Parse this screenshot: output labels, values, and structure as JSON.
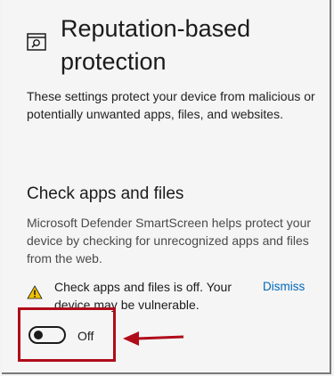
{
  "header": {
    "icon": "app-browser-control-icon",
    "title": "Reputation-based protection"
  },
  "intro": "These settings protect your device from malicious or potentially unwanted apps, files, and websites.",
  "section": {
    "title": "Check apps and files",
    "description": "Microsoft Defender SmartScreen helps protect your device by checking for unrecognized apps and files from the web."
  },
  "warning": {
    "icon": "warning-icon",
    "text": "Check apps and files is off. Your device may be vulnerable.",
    "dismiss_label": "Dismiss"
  },
  "toggle": {
    "state": "off",
    "label": "Off"
  },
  "annotation": {
    "highlight_color": "#b00c1a",
    "arrow_color": "#b00c1a"
  }
}
